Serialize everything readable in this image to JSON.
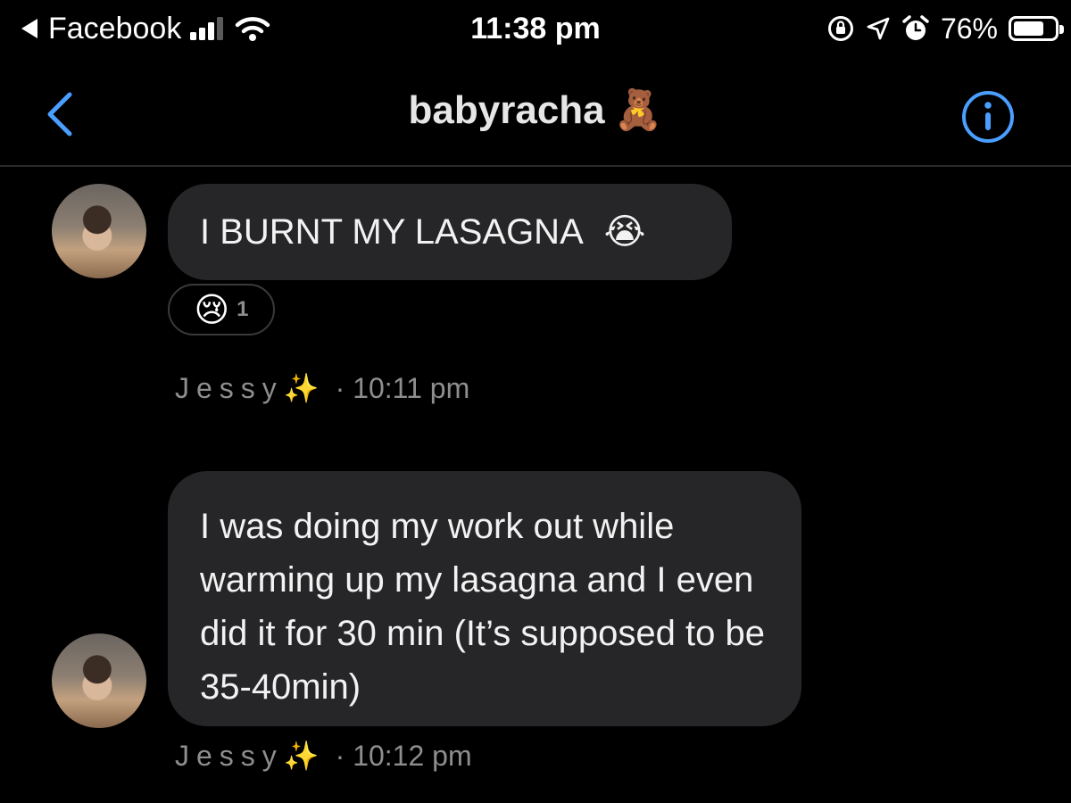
{
  "status_bar": {
    "back_app": "Facebook",
    "time": "11:38 pm",
    "battery_text": "76%",
    "battery_level": 0.76
  },
  "header": {
    "title": "babyracha",
    "title_emoji": "🧸"
  },
  "messages": [
    {
      "text": "I BURNT MY LASAGNA",
      "emoji": "😭",
      "reaction": {
        "emoji": "😢",
        "count": "1"
      },
      "sender": "Jessy",
      "sender_emoji": "✨",
      "time": "· 10:11 pm"
    },
    {
      "text": "I was doing my work out while warming up my lasagna and I even did it for 30 min (It’s supposed to be 35-40min)",
      "sender": "Jessy",
      "sender_emoji": "✨",
      "time": "· 10:12 pm"
    }
  ],
  "colors": {
    "accent": "#4a9eff",
    "bubble": "#262628",
    "meta_text": "#8e8e8e",
    "background": "#000000"
  },
  "icons": [
    "back-arrow-icon",
    "signal-icon",
    "wifi-icon",
    "rotation-lock-icon",
    "location-icon",
    "alarm-icon",
    "battery-icon",
    "chevron-left-icon",
    "info-icon"
  ]
}
